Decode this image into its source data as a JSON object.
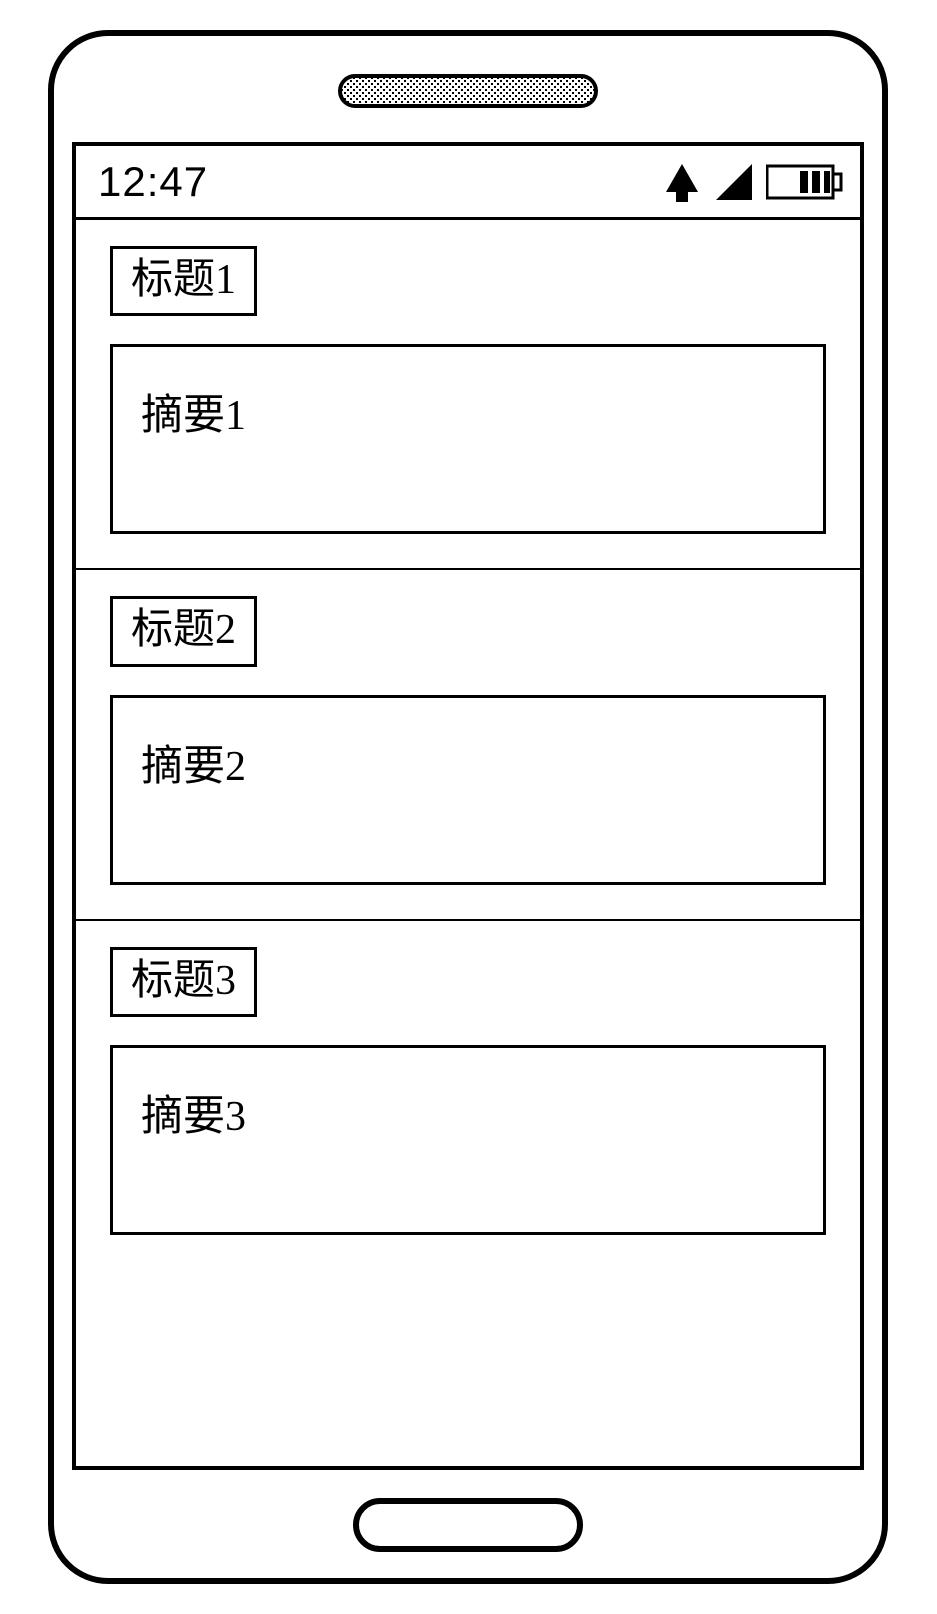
{
  "status": {
    "time": "12:47"
  },
  "list": [
    {
      "title": "标题1",
      "summary": "摘要1"
    },
    {
      "title": "标题2",
      "summary": "摘要2"
    },
    {
      "title": "标题3",
      "summary": "摘要3"
    }
  ]
}
